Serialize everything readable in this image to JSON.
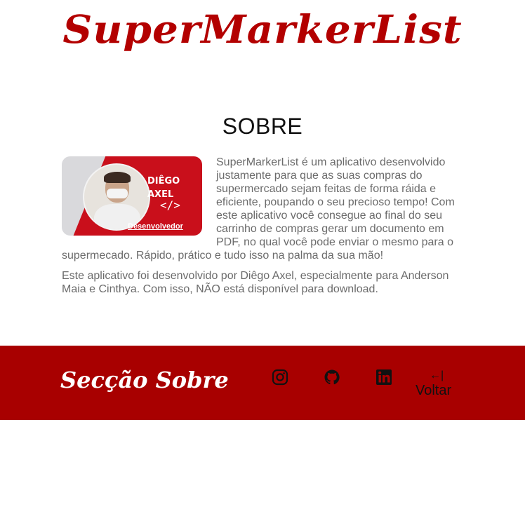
{
  "header": {
    "brand": "SuperMarkerList"
  },
  "main": {
    "section_title": "SOBRE",
    "card": {
      "name": "DIÊGO AXEL",
      "code_icon": "</>",
      "role": "Desenvolvedor"
    },
    "paragraphs": [
      "SuperMarkerList é um aplicativo desenvolvido justamente para que as suas compras do supermercado sejam feitas de forma ráida e eficiente, poupando o seu precioso tempo! Com este aplicativo você consegue ao final do seu carrinho de compras gerar um documento em PDF, no qual você pode enviar o mesmo para o supermecado. Rápido, prático e tudo isso na palma da sua mão!",
      "Este aplicativo foi desenvolvido por Diêgo Axel, especialmente para Anderson Maia e Cinthya. Com isso, NÃO está disponível para download."
    ]
  },
  "footer": {
    "title": "Secção Sobre",
    "icons": [
      "instagram-icon",
      "github-icon",
      "linkedin-icon"
    ],
    "back": {
      "arrow": "←|",
      "label": "Voltar"
    }
  },
  "colors": {
    "brand_red": "#b30000",
    "footer_bg": "#a80000",
    "text_gray": "#6b6b6b"
  }
}
